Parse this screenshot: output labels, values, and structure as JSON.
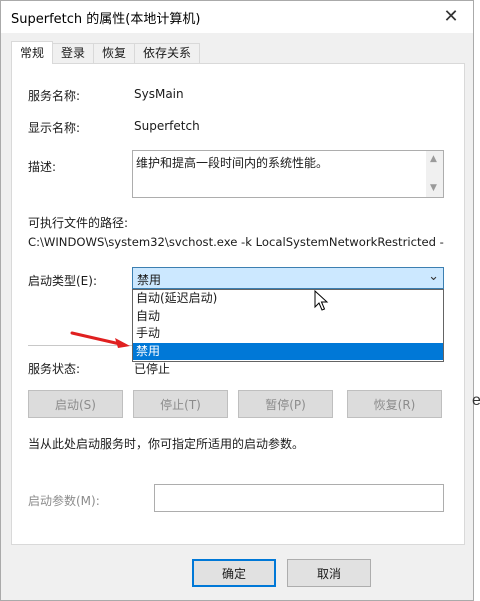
{
  "window": {
    "title": "Superfetch 的属性(本地计算机)"
  },
  "tabs": [
    {
      "label": "常规",
      "active": true
    },
    {
      "label": "登录",
      "active": false
    },
    {
      "label": "恢复",
      "active": false
    },
    {
      "label": "依存关系",
      "active": false
    }
  ],
  "general": {
    "service_name_label": "服务名称:",
    "service_name_value": "SysMain",
    "display_name_label": "显示名称:",
    "display_name_value": "Superfetch",
    "description_label": "描述:",
    "description_value": "维护和提高一段时间内的系统性能。",
    "exe_path_label": "可执行文件的路径:",
    "exe_path_value": "C:\\WINDOWS\\system32\\svchost.exe -k LocalSystemNetworkRestricted -",
    "startup_type_label": "启动类型(E):",
    "startup_type_value": "禁用",
    "startup_options": [
      "自动(延迟启动)",
      "自动",
      "手动",
      "禁用"
    ],
    "service_status_label": "服务状态:",
    "service_status_value": "已停止",
    "buttons": {
      "start": "启动(S)",
      "stop": "停止(T)",
      "pause": "暂停(P)",
      "resume": "恢复(R)"
    },
    "hint": "当从此处启动服务时，你可指定所适用的启动参数。",
    "start_params_label": "启动参数(M):",
    "start_params_value": ""
  },
  "footer": {
    "ok": "确定",
    "cancel": "取消"
  },
  "icons": {
    "close": "close-icon",
    "combo_arrow": "chevron-down-icon",
    "cursor": "mouse-pointer-icon",
    "annotation": "red-arrow-icon"
  },
  "colors": {
    "selection": "#0078d7",
    "combo_highlight": "#cce8ff",
    "annotation_red": "#e02020"
  }
}
